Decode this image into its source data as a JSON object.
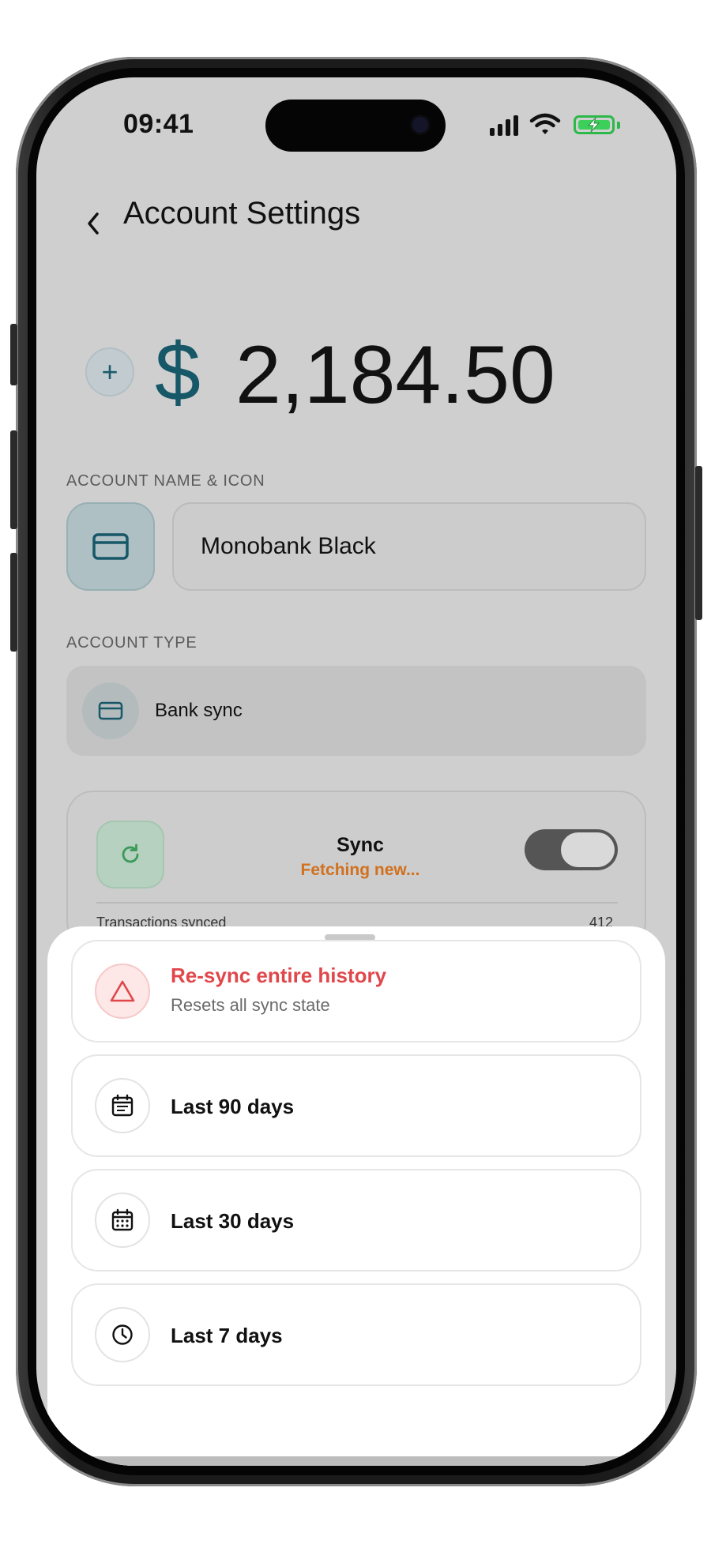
{
  "status_bar": {
    "time": "09:41"
  },
  "header": {
    "title": "Account Settings"
  },
  "balance": {
    "currency_symbol": "$",
    "amount": "2,184.50"
  },
  "account_name_section": {
    "label": "ACCOUNT NAME & ICON",
    "name_value": "Monobank Black",
    "icon": "card-icon"
  },
  "account_type_section": {
    "label": "ACCOUNT TYPE",
    "type_value": "Bank sync",
    "icon": "card-icon"
  },
  "sync_card": {
    "title": "Sync",
    "status": "Fetching new...",
    "toggle_on": true,
    "peek_label": "Transactions synced",
    "peek_value": "412"
  },
  "sheet": {
    "options": [
      {
        "title": "Re-sync entire history",
        "subtitle": "Resets all sync state",
        "icon": "warning-triangle-icon",
        "danger": true
      },
      {
        "title": "Last 90 days",
        "icon": "calendar-list-icon"
      },
      {
        "title": "Last 30 days",
        "icon": "calendar-grid-icon"
      },
      {
        "title": "Last 7 days",
        "icon": "clock-icon"
      }
    ]
  },
  "colors": {
    "accent_teal": "#165768",
    "status_orange": "#d2701e",
    "danger_red": "#e0474b",
    "sync_green": "#3a9a5a"
  }
}
